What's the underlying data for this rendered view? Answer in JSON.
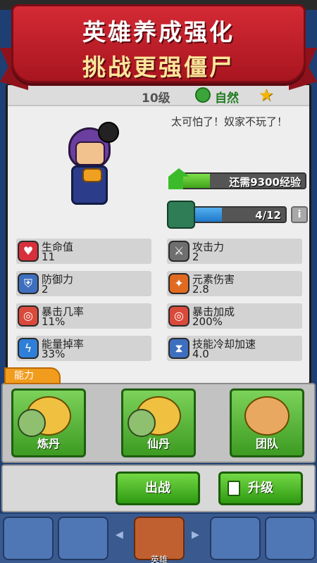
{
  "banner": {
    "line1": "英雄养成强化",
    "line2": "挑战更强僵尸"
  },
  "hero": {
    "level": "10级",
    "element": "自然",
    "element_icon": "leaf-icon",
    "quote": "太可怕了！奴家不玩了！",
    "exp_text": "还需9300经验",
    "exp_progress": 0.25,
    "shards_text": "4/12",
    "shards_progress": 0.33
  },
  "stats": [
    {
      "label": "生命值",
      "value": "11",
      "icon": "heart-icon",
      "color": "#d7303c"
    },
    {
      "label": "攻击力",
      "value": "2",
      "icon": "sword-icon",
      "color": "#6f6f6f"
    },
    {
      "label": "防御力",
      "value": "2",
      "icon": "shield-icon",
      "color": "#3e6fbf"
    },
    {
      "label": "元素伤害",
      "value": "2.8",
      "icon": "elements-icon",
      "color": "#e06a20"
    },
    {
      "label": "暴击几率",
      "value": "11%",
      "icon": "crit-target-icon",
      "color": "#d94a3a"
    },
    {
      "label": "暴击加成",
      "value": "200%",
      "icon": "crit-bonus-icon",
      "color": "#d94a3a"
    },
    {
      "label": "能量掉率",
      "value": "33%",
      "icon": "lightning-icon",
      "color": "#2f7fd8"
    },
    {
      "label": "技能冷却加速",
      "value": "4.0",
      "icon": "hourglass-icon",
      "color": "#3e6fbf"
    }
  ],
  "abilities": {
    "tab": "能力",
    "items": [
      {
        "label": "炼丹",
        "icon": "alchemy-icon"
      },
      {
        "label": "仙丹",
        "icon": "elixir-icon"
      },
      {
        "label": "团队",
        "icon": "team-fists-icon"
      }
    ]
  },
  "actions": {
    "deploy": "出战",
    "upgrade": "升级"
  },
  "nav": {
    "active_label": "英雄"
  },
  "colors": {
    "banner_red": "#c51f2a",
    "button_green": "#3fa21a",
    "exp_green": "#5fc32a",
    "shard_blue": "#1e78c8",
    "ability_tab_orange": "#f29c1e"
  }
}
